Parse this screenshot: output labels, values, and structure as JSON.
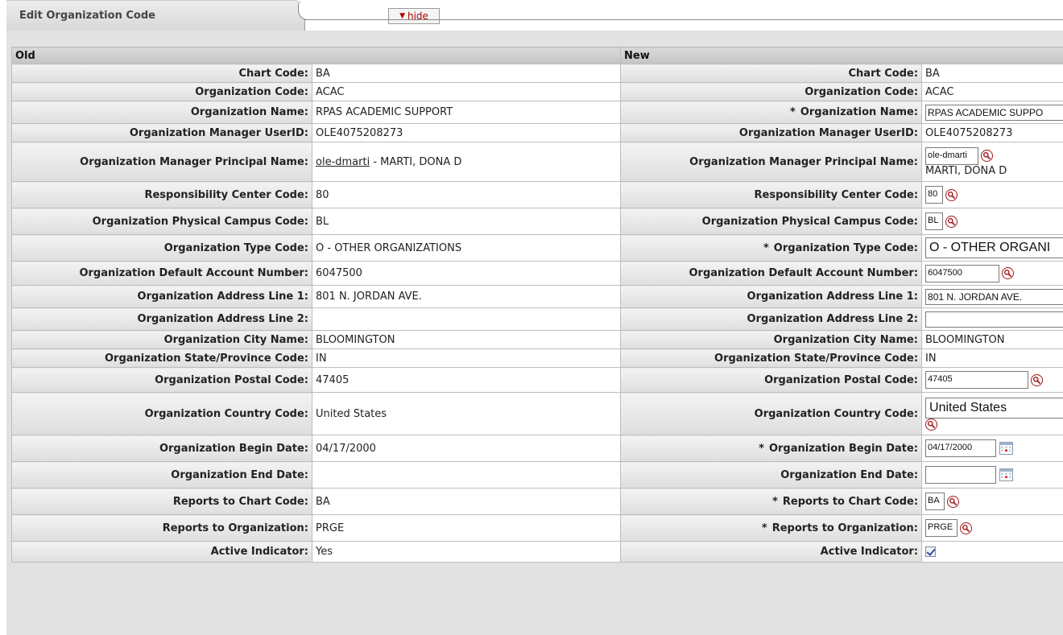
{
  "tab": {
    "title": "Edit Organization Code",
    "hide_label": "hide"
  },
  "columns": {
    "old": "Old",
    "new": "New"
  },
  "rows": [
    {
      "label": "Chart Code:",
      "old": "BA",
      "new": "BA"
    },
    {
      "label": "Organization Code:",
      "old": "ACAC",
      "new": "ACAC"
    },
    {
      "label": "Organization Name:",
      "old": "RPAS ACADEMIC SUPPORT",
      "new": "RPAS ACADEMIC SUPPO"
    },
    {
      "label": "Organization Manager UserID:",
      "old": "OLE4075208273",
      "new": "OLE4075208273"
    },
    {
      "label": "Organization Manager Principal Name:",
      "old_link": "ole-dmarti",
      "old_suffix": " - MARTI, DONA D",
      "new": "ole-dmarti",
      "new_sub": "MARTI, DONA D"
    },
    {
      "label": "Responsibility Center Code:",
      "old": "80",
      "new": "80"
    },
    {
      "label": "Organization Physical Campus Code:",
      "old": "BL",
      "new": "BL"
    },
    {
      "label": "Organization Type Code:",
      "old": "O - OTHER ORGANIZATIONS",
      "new": "O - OTHER ORGANI"
    },
    {
      "label": "Organization Default Account Number:",
      "old": "6047500",
      "new": "6047500"
    },
    {
      "label": "Organization Address Line 1:",
      "old": "801 N. JORDAN AVE.",
      "new": "801 N. JORDAN AVE."
    },
    {
      "label": "Organization Address Line 2:",
      "old": "",
      "new": ""
    },
    {
      "label": "Organization City Name:",
      "old": "BLOOMINGTON",
      "new": "BLOOMINGTON"
    },
    {
      "label": "Organization State/Province Code:",
      "old": "IN",
      "new": "IN"
    },
    {
      "label": "Organization Postal Code:",
      "old": "47405",
      "new": "47405"
    },
    {
      "label": "Organization Country Code:",
      "old": "United States",
      "new": "United States"
    },
    {
      "label": "Organization Begin Date:",
      "old": "04/17/2000",
      "new": "04/17/2000"
    },
    {
      "label": "Organization End Date:",
      "old": "",
      "new": ""
    },
    {
      "label": "Reports to Chart Code:",
      "old": "BA",
      "new": "BA"
    },
    {
      "label": "Reports to Organization:",
      "old": "PRGE",
      "new": "PRGE"
    },
    {
      "label": "Active Indicator:",
      "old": "Yes",
      "new_checked": true
    }
  ],
  "required_marker": "*",
  "icons": {
    "lookup": "magnifier-icon",
    "calendar": "calendar-icon",
    "checkbox": "checkbox-checked"
  },
  "colors": {
    "header_bg": "#c8c8c8",
    "label_bg": "#e6e6e6",
    "hide_text": "#b00000",
    "icon_red": "#a01818"
  }
}
